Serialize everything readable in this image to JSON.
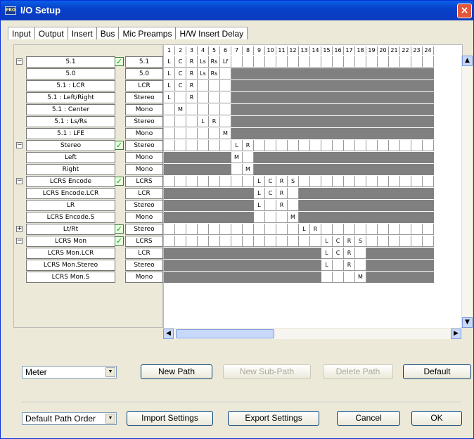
{
  "window": {
    "title": "I/O Setup",
    "app_icon": "PRO",
    "close": "×"
  },
  "tabs": [
    "Input",
    "Output",
    "Insert",
    "Bus",
    "Mic Preamps",
    "H/W Insert Delay"
  ],
  "active_tab": "Bus",
  "columns": [
    "1",
    "2",
    "3",
    "4",
    "5",
    "6",
    "7",
    "8",
    "9",
    "10",
    "11",
    "12",
    "13",
    "14",
    "15",
    "16",
    "17",
    "18",
    "19",
    "20",
    "21",
    "22",
    "23",
    "24"
  ],
  "rows": [
    {
      "expander": "−",
      "name": "5.1",
      "check": true,
      "type": "5.1",
      "cells": {
        "1": "L",
        "2": "C",
        "3": "R",
        "4": "Ls",
        "5": "Rs",
        "6": "Lf"
      },
      "active": [
        1,
        24
      ]
    },
    {
      "expander": "",
      "name": "5.0",
      "check": false,
      "type": "5.0",
      "cells": {
        "1": "L",
        "2": "C",
        "3": "R",
        "4": "Ls",
        "5": "Rs"
      },
      "active": [
        1,
        6
      ]
    },
    {
      "expander": "",
      "name": "5.1 : LCR",
      "check": false,
      "type": "LCR",
      "cells": {
        "1": "L",
        "2": "C",
        "3": "R"
      },
      "active": [
        1,
        6
      ]
    },
    {
      "expander": "",
      "name": "5.1 : Left/Right",
      "check": false,
      "type": "Stereo",
      "cells": {
        "1": "L",
        "3": "R"
      },
      "active": [
        1,
        6
      ]
    },
    {
      "expander": "",
      "name": "5.1 : Center",
      "check": false,
      "type": "Mono",
      "cells": {
        "2": "M"
      },
      "active": [
        1,
        6
      ]
    },
    {
      "expander": "",
      "name": "5.1 : Ls/Rs",
      "check": false,
      "type": "Stereo",
      "cells": {
        "4": "L",
        "5": "R"
      },
      "active": [
        1,
        6
      ]
    },
    {
      "expander": "",
      "name": "5.1 : LFE",
      "check": false,
      "type": "Mono",
      "cells": {
        "6": "M"
      },
      "active": [
        1,
        6
      ]
    },
    {
      "expander": "−",
      "name": "Stereo",
      "check": true,
      "type": "Stereo",
      "cells": {
        "7": "L",
        "8": "R"
      },
      "active": [
        1,
        24
      ]
    },
    {
      "expander": "",
      "name": "Left",
      "check": false,
      "type": "Mono",
      "cells": {
        "7": "M"
      },
      "active": [
        7,
        8
      ]
    },
    {
      "expander": "",
      "name": "Right",
      "check": false,
      "type": "Mono",
      "cells": {
        "8": "M"
      },
      "active": [
        7,
        8
      ]
    },
    {
      "expander": "−",
      "name": "LCRS Encode",
      "check": true,
      "type": "LCRS",
      "cells": {
        "9": "L",
        "10": "C",
        "11": "R",
        "12": "S"
      },
      "active": [
        1,
        24
      ]
    },
    {
      "expander": "",
      "name": "LCRS Encode.LCR",
      "check": false,
      "type": "LCR",
      "cells": {
        "9": "L",
        "10": "C",
        "11": "R"
      },
      "active": [
        9,
        12
      ]
    },
    {
      "expander": "",
      "name": "LR",
      "check": false,
      "type": "Stereo",
      "cells": {
        "9": "L",
        "11": "R"
      },
      "active": [
        9,
        12
      ]
    },
    {
      "expander": "",
      "name": "LCRS Encode.S",
      "check": false,
      "type": "Mono",
      "cells": {
        "12": "M"
      },
      "active": [
        9,
        12
      ]
    },
    {
      "expander": "+",
      "name": "Lt/Rt",
      "check": true,
      "type": "Stereo",
      "cells": {
        "13": "L",
        "14": "R"
      },
      "active": [
        1,
        24
      ]
    },
    {
      "expander": "−",
      "name": "LCRS Mon",
      "check": true,
      "type": "LCRS",
      "cells": {
        "15": "L",
        "16": "C",
        "17": "R",
        "18": "S"
      },
      "active": [
        1,
        24
      ]
    },
    {
      "expander": "",
      "name": "LCRS Mon.LCR",
      "check": false,
      "type": "LCR",
      "cells": {
        "15": "L",
        "16": "C",
        "17": "R"
      },
      "active": [
        15,
        18
      ]
    },
    {
      "expander": "",
      "name": "LCRS Mon.Stereo",
      "check": false,
      "type": "Stereo",
      "cells": {
        "15": "L",
        "17": "R"
      },
      "active": [
        15,
        18
      ]
    },
    {
      "expander": "",
      "name": "LCRS Mon.S",
      "check": false,
      "type": "Mono",
      "cells": {
        "18": "M"
      },
      "active": [
        15,
        18
      ]
    }
  ],
  "controls": {
    "meter_select": "Meter",
    "new_path": "New Path",
    "new_sub_path": "New Sub-Path",
    "delete_path": "Delete Path",
    "default": "Default",
    "path_order_select": "Default Path Order",
    "import_settings": "Import Settings",
    "export_settings": "Export Settings",
    "cancel": "Cancel",
    "ok": "OK"
  },
  "scroll_icons": {
    "left": "◀",
    "right": "▶",
    "up": "▲",
    "down": "▼",
    "dd": "▼"
  }
}
